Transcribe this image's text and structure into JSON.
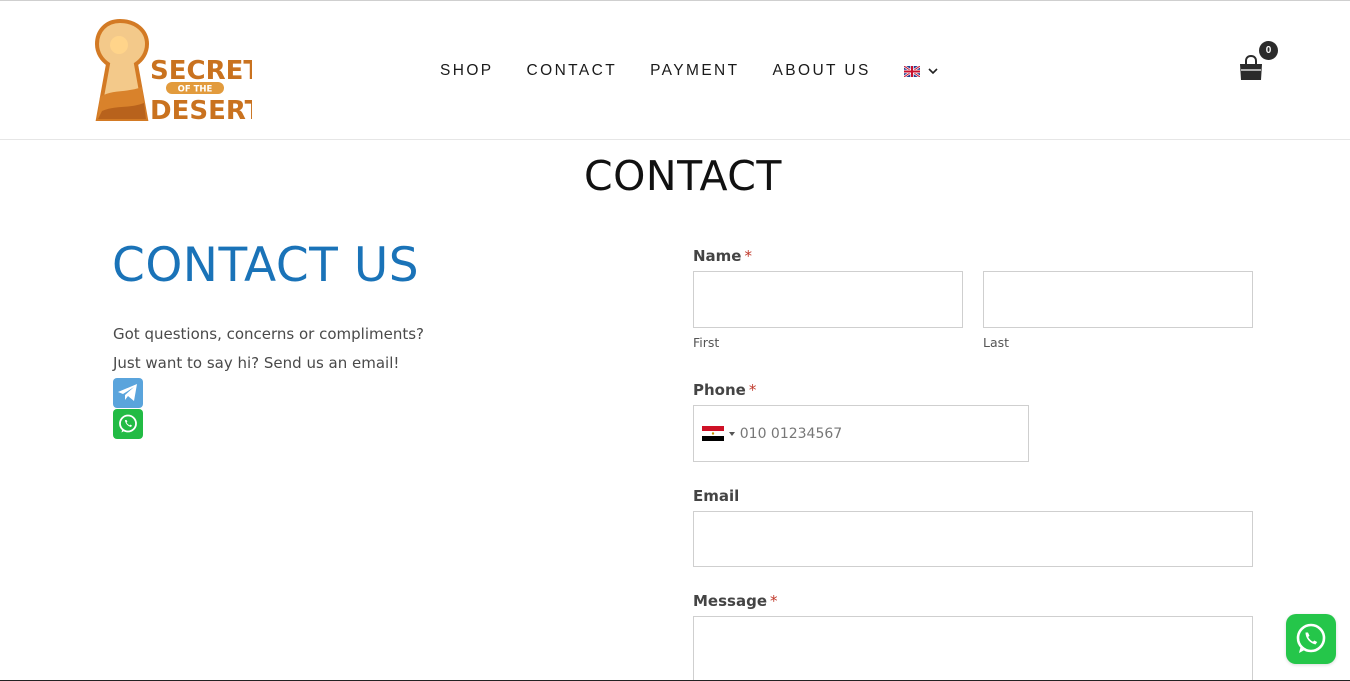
{
  "header": {
    "logo": {
      "text_line1": "SECRET",
      "text_middle": "OF THE",
      "text_line2": "DESERT",
      "alt": "Secret of the Desert logo"
    },
    "nav": [
      {
        "label": "SHOP"
      },
      {
        "label": "CONTACT"
      },
      {
        "label": "PAYMENT"
      },
      {
        "label": "ABOUT US"
      }
    ],
    "language": {
      "icon": "uk-flag-icon"
    },
    "cart": {
      "count": "0",
      "icon": "shopping-bag-icon"
    }
  },
  "page": {
    "title": "CONTACT"
  },
  "contact": {
    "heading": "CONTACT US",
    "intro_line1": "Got questions, concerns or compliments?",
    "intro_line2": "Just want to say hi? Send us an email!",
    "social": [
      {
        "name": "telegram-icon"
      },
      {
        "name": "whatsapp-icon"
      }
    ]
  },
  "form": {
    "name": {
      "label": "Name",
      "required_mark": "*",
      "first_sublabel": "First",
      "last_sublabel": "Last",
      "first_value": "",
      "last_value": ""
    },
    "phone": {
      "label": "Phone",
      "required_mark": "*",
      "placeholder": "010 01234567",
      "value": "",
      "country_icon": "egypt-flag-icon"
    },
    "email": {
      "label": "Email",
      "value": ""
    },
    "message": {
      "label": "Message",
      "required_mark": "*",
      "value": ""
    }
  },
  "floating": {
    "icon": "whatsapp-icon"
  },
  "colors": {
    "heading_blue": "#1a73b8",
    "required_red": "#c0392b",
    "whatsapp_green": "#25c64a",
    "telegram_blue": "#5aa4dc",
    "logo_orange": "#d9822b"
  }
}
